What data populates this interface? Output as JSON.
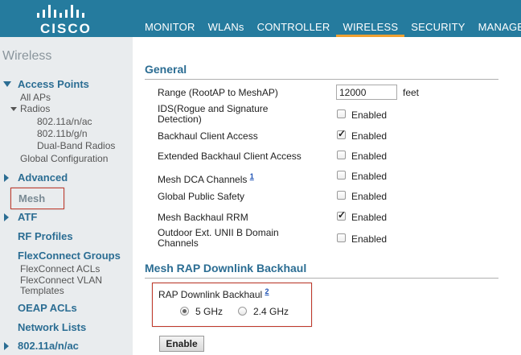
{
  "brand": "CISCO",
  "nav": [
    {
      "label": "MONITOR"
    },
    {
      "label": "WLANs"
    },
    {
      "label": "CONTROLLER"
    },
    {
      "label": "WIRELESS"
    },
    {
      "label": "SECURITY"
    },
    {
      "label": "MANAGEM"
    }
  ],
  "active_nav": "WIRELESS",
  "accent_color": "#257b9e",
  "sidebar": {
    "title": "Wireless",
    "access_points": "Access Points",
    "all_aps": "All APs",
    "radios": "Radios",
    "radio_a": "802.11a/n/ac",
    "radio_b": "802.11b/g/n",
    "radio_dual": "Dual-Band Radios",
    "global_config": "Global Configuration",
    "advanced": "Advanced",
    "mesh": "Mesh",
    "atf": "ATF",
    "rf_profiles": "RF Profiles",
    "flexconnect_groups": "FlexConnect Groups",
    "flexconnect_acls": "FlexConnect ACLs",
    "flexconnect_vlan_1": "FlexConnect VLAN",
    "flexconnect_vlan_2": "Templates",
    "oeap_acls": "OEAP ACLs",
    "network_lists": "Network Lists",
    "radio_80211an": "802.11a/n/ac"
  },
  "general": {
    "title": "General",
    "range_label": "Range (RootAP to MeshAP)",
    "range_value": "12000",
    "range_unit": "feet",
    "ids_label_1": "IDS(Rogue and Signature",
    "ids_label_2": "Detection)",
    "backhaul_client": "Backhaul Client Access",
    "ext_backhaul_client": "Extended Backhaul Client Access",
    "mesh_dca": "Mesh DCA Channels",
    "mesh_dca_footnote": "1",
    "global_public_safety": "Global Public Safety",
    "mesh_backhaul_rrm": "Mesh Backhaul RRM",
    "outdoor_1": "Outdoor Ext. UNII B Domain",
    "outdoor_2": "Channels",
    "enabled": "Enabled",
    "checked": {
      "ids": false,
      "backhaul_client": true,
      "ext_backhaul_client": false,
      "mesh_dca": false,
      "global_public_safety": false,
      "mesh_backhaul_rrm": true,
      "outdoor": false
    }
  },
  "rap": {
    "title": "Mesh RAP Downlink Backhaul",
    "label": "RAP Downlink Backhaul",
    "footnote": "2",
    "opt_5": "5 GHz",
    "opt_24": "2.4 GHz",
    "selected": "5 GHz"
  },
  "enable_button": "Enable"
}
